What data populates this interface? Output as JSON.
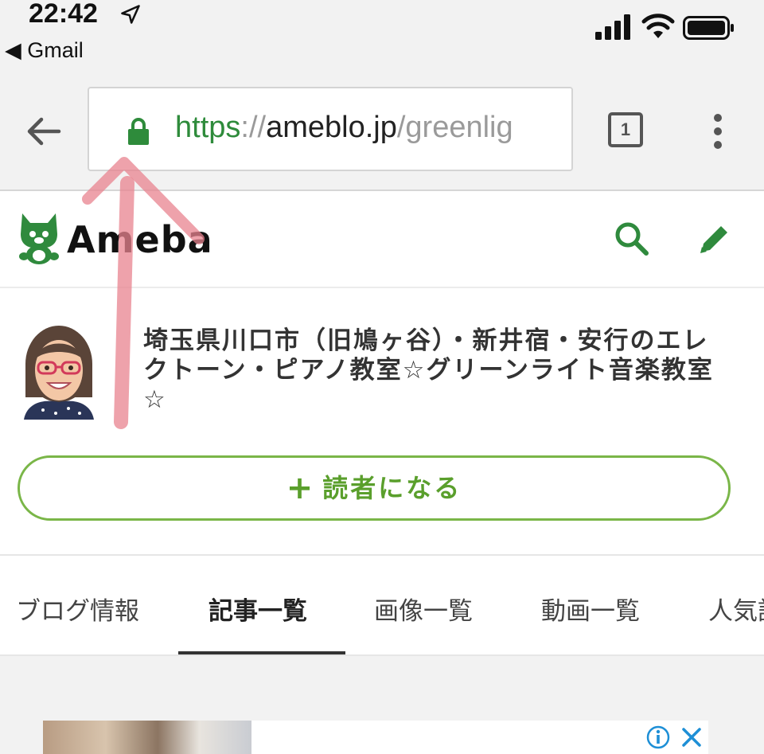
{
  "status_bar": {
    "time": "22:42",
    "back_app": "◀ Gmail",
    "location_icon": "location-arrow-icon",
    "signal_icon": "cellular-signal-icon",
    "wifi_icon": "wifi-icon",
    "battery_icon": "battery-icon"
  },
  "browser": {
    "url_scheme": "https",
    "url_sep": "://",
    "url_host": "ameblo.jp",
    "url_path": "/greenlig",
    "tab_count": "1",
    "colors": {
      "secure": "#2e8b3b"
    }
  },
  "ameba": {
    "logo_text": "Ameba",
    "accent_color": "#5a9f2c"
  },
  "blog": {
    "title": "埼玉県川口市（旧鳩ヶ谷）・新井宿・安行のエレクトーン・ピアノ教室☆グリーンライト音楽教室☆",
    "follow_plus": "+",
    "follow_label": "読者になる"
  },
  "tabs": [
    {
      "label": "ブログ情報",
      "active": false
    },
    {
      "label": "記事一覧",
      "active": true
    },
    {
      "label": "画像一覧",
      "active": false
    },
    {
      "label": "動画一覧",
      "active": false
    },
    {
      "label": "人気記",
      "active": false
    }
  ],
  "ad": {
    "info_icon": "info-icon",
    "close_icon": "close-icon"
  }
}
